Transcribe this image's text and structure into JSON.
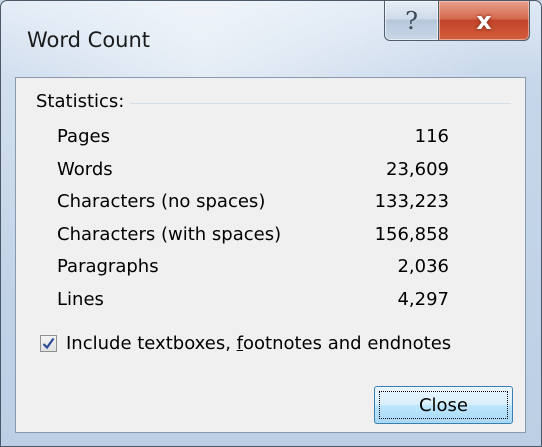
{
  "window": {
    "title": "Word Count",
    "help_glyph": "?",
    "close_glyph": "x"
  },
  "statistics": {
    "heading": "Statistics:",
    "rows": [
      {
        "label": "Pages",
        "value": "116"
      },
      {
        "label": "Words",
        "value": "23,609"
      },
      {
        "label": "Characters (no spaces)",
        "value": "133,223"
      },
      {
        "label": "Characters (with spaces)",
        "value": "156,858"
      },
      {
        "label": "Paragraphs",
        "value": "2,036"
      },
      {
        "label": "Lines",
        "value": "4,297"
      }
    ]
  },
  "include_option": {
    "label_pre": "Include textboxes, ",
    "label_accel": "f",
    "label_post": "ootnotes and endnotes",
    "checked": true
  },
  "buttons": {
    "close_label": "Close"
  },
  "icons": {
    "help": "help-icon",
    "close": "close-icon",
    "check": "checkmark-icon"
  },
  "colors": {
    "close_caption_button": "#c2442a",
    "default_button_border": "#3c7fb1",
    "checkmark": "#2a4e9a"
  }
}
